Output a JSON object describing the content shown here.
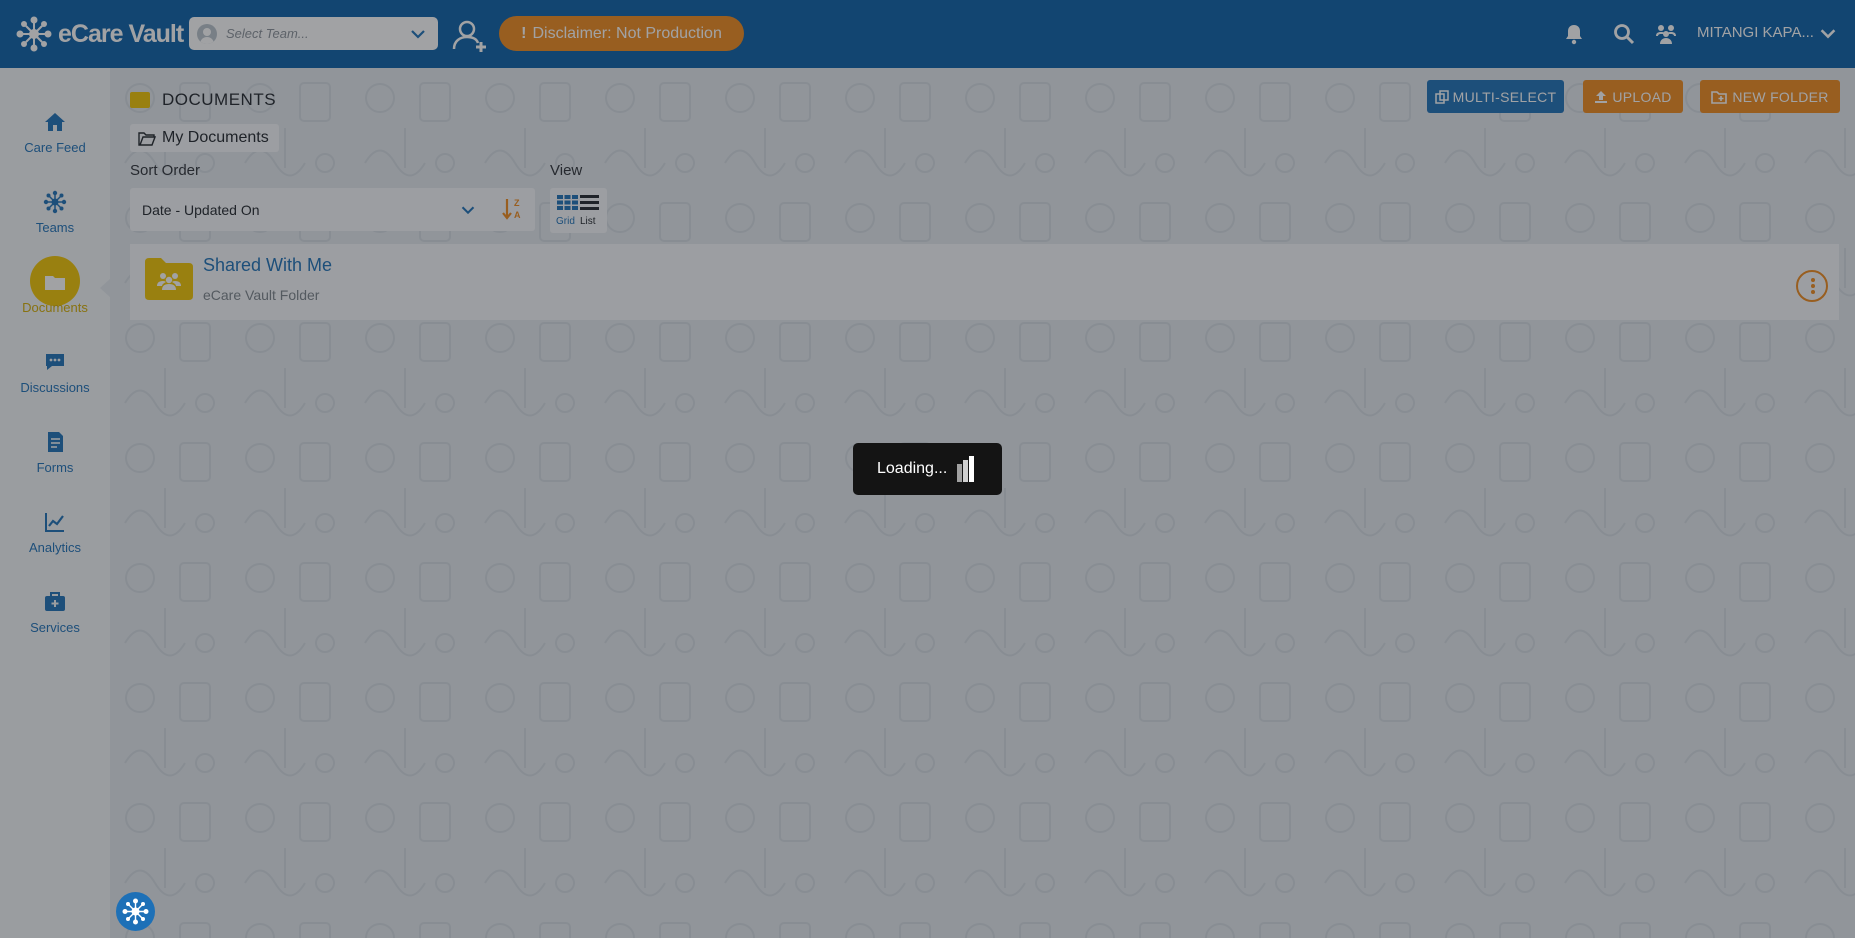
{
  "app": {
    "brand": "eCare Vault"
  },
  "header": {
    "team_placeholder": "Select Team...",
    "disclaimer": "Disclaimer: Not Production",
    "user_name": "MITANGI KAPA..."
  },
  "sidebar": {
    "items": [
      {
        "label": "Care Feed",
        "icon": "home-icon"
      },
      {
        "label": "Teams",
        "icon": "teams-icon"
      },
      {
        "label": "Documents",
        "icon": "folder-icon",
        "active": true
      },
      {
        "label": "Discussions",
        "icon": "chat-icon"
      },
      {
        "label": "Forms",
        "icon": "form-icon"
      },
      {
        "label": "Analytics",
        "icon": "chart-icon"
      },
      {
        "label": "Services",
        "icon": "briefcase-icon"
      }
    ]
  },
  "main": {
    "title": "DOCUMENTS",
    "buttons": {
      "multi_select": "MULTI-SELECT",
      "upload": "UPLOAD",
      "new_folder": "NEW FOLDER"
    },
    "breadcrumb": "My Documents",
    "sort_label": "Sort Order",
    "sort_value": "Date - Updated On",
    "view_label": "View",
    "view_grid": "Grid",
    "view_list": "List",
    "rows": [
      {
        "name": "Shared With Me",
        "subtitle": "eCare Vault Folder"
      }
    ]
  },
  "overlay": {
    "loading": "Loading..."
  },
  "colors": {
    "brand_blue": "#0a5fa8",
    "accent_blue": "#1d70b7",
    "orange": "#f08a1c",
    "yellow": "#f2c500"
  }
}
